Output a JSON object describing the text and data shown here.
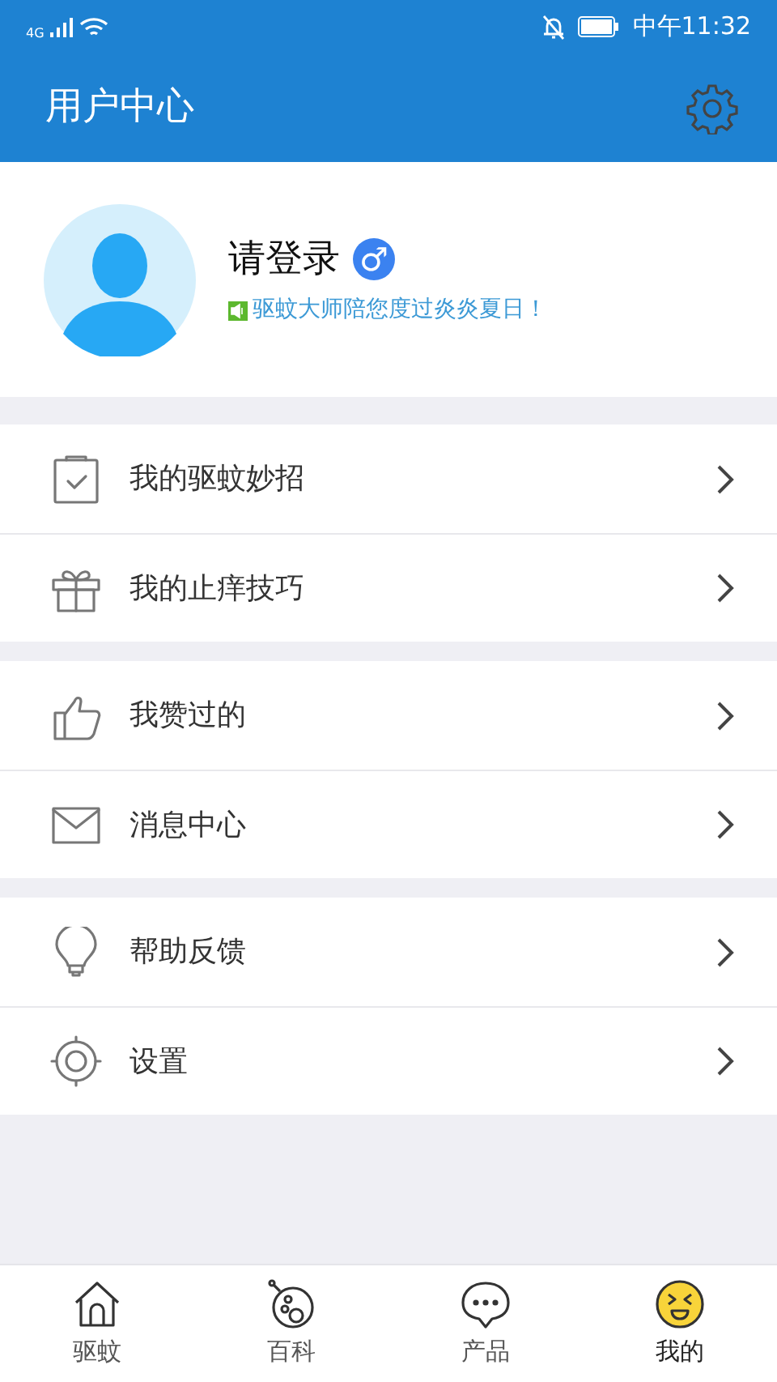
{
  "status_bar": {
    "network": "4G",
    "time": "中午11:32"
  },
  "header": {
    "title": "用户中心"
  },
  "profile": {
    "name": "请登录",
    "gender_symbol": "♂",
    "slogan": "驱蚊大师陪您度过炎炎夏日！"
  },
  "menu_groups": [
    [
      {
        "kind": "clipboard",
        "label": "我的驱蚊妙招"
      },
      {
        "kind": "gift",
        "label": "我的止痒技巧"
      }
    ],
    [
      {
        "kind": "thumb",
        "label": "我赞过的"
      },
      {
        "kind": "mail",
        "label": "消息中心"
      }
    ],
    [
      {
        "kind": "bulb",
        "label": "帮助反馈"
      },
      {
        "kind": "target",
        "label": "设置"
      }
    ]
  ],
  "tabs": [
    {
      "kind": "home",
      "label": "驱蚊",
      "selected": false
    },
    {
      "kind": "ball",
      "label": "百科",
      "selected": false
    },
    {
      "kind": "chat",
      "label": "产品",
      "selected": false
    },
    {
      "kind": "face",
      "label": "我的",
      "selected": true
    }
  ]
}
